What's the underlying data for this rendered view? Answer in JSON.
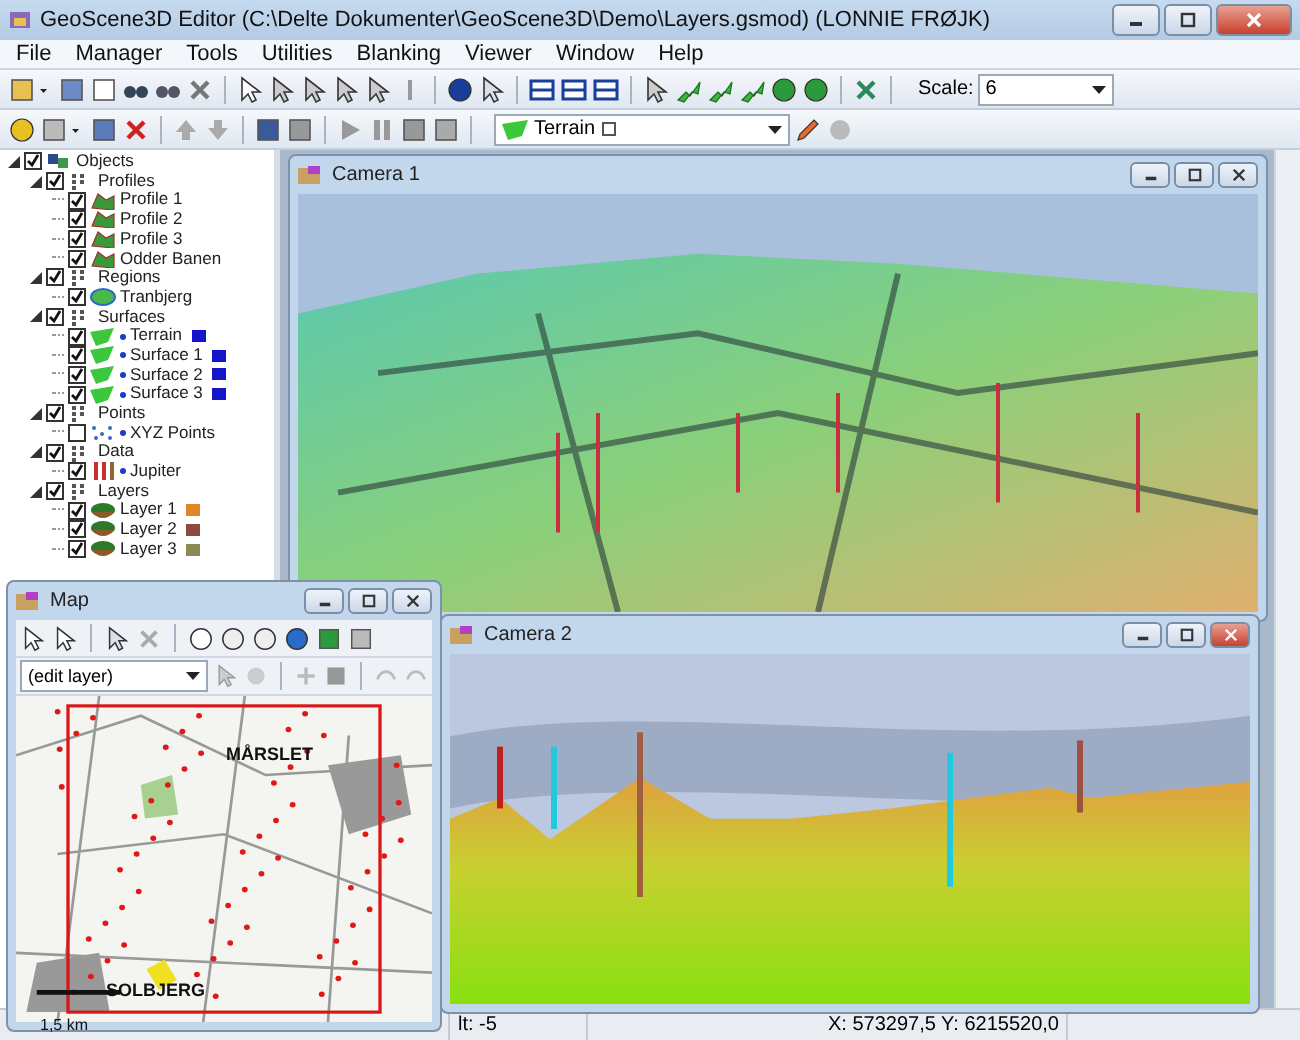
{
  "window": {
    "title": "GeoScene3D Editor (C:\\Delte Dokumenter\\GeoScene3D\\Demo\\Layers.gsmod) (LONNIE FRØJK)"
  },
  "menu": [
    "File",
    "Manager",
    "Tools",
    "Utilities",
    "Blanking",
    "Viewer",
    "Window",
    "Help"
  ],
  "toolbar": {
    "scale_label": "Scale:",
    "scale_value": "6",
    "layer_dropdown": "Terrain"
  },
  "tree": [
    {
      "label": "Objects",
      "kind": "objects",
      "checked": true,
      "expanded": true,
      "children": [
        {
          "label": "Profiles",
          "kind": "group",
          "checked": true,
          "expanded": true,
          "children": [
            {
              "label": "Profile 1",
              "kind": "profile",
              "checked": true
            },
            {
              "label": "Profile 2",
              "kind": "profile",
              "checked": true
            },
            {
              "label": "Profile 3",
              "kind": "profile",
              "checked": true
            },
            {
              "label": "Odder Banen",
              "kind": "profile",
              "checked": true
            }
          ]
        },
        {
          "label": "Regions",
          "kind": "group",
          "checked": true,
          "expanded": true,
          "children": [
            {
              "label": "Tranbjerg",
              "kind": "region",
              "checked": true
            }
          ]
        },
        {
          "label": "Surfaces",
          "kind": "group",
          "checked": true,
          "expanded": true,
          "children": [
            {
              "label": "Terrain",
              "kind": "surface",
              "checked": true,
              "color": "#1414c8"
            },
            {
              "label": "Surface 1",
              "kind": "surface",
              "checked": true,
              "color": "#1414c8"
            },
            {
              "label": "Surface 2",
              "kind": "surface",
              "checked": true,
              "color": "#1414c8"
            },
            {
              "label": "Surface 3",
              "kind": "surface",
              "checked": true,
              "color": "#1414c8"
            }
          ]
        },
        {
          "label": "Points",
          "kind": "group",
          "checked": true,
          "expanded": true,
          "children": [
            {
              "label": "XYZ Points",
              "kind": "points",
              "checked": false
            }
          ]
        },
        {
          "label": "Data",
          "kind": "group",
          "checked": true,
          "expanded": true,
          "children": [
            {
              "label": "Jupiter",
              "kind": "data",
              "checked": true
            }
          ]
        },
        {
          "label": "Layers",
          "kind": "group",
          "checked": true,
          "expanded": true,
          "children": [
            {
              "label": "Layer 1",
              "kind": "layer",
              "checked": true,
              "color": "#e0862a"
            },
            {
              "label": "Layer 2",
              "kind": "layer",
              "checked": true,
              "color": "#8c4a40"
            },
            {
              "label": "Layer 3",
              "kind": "layer",
              "checked": true,
              "color": "#8a8a52"
            }
          ]
        }
      ]
    }
  ],
  "camera_windows": [
    {
      "title": "Camera 1"
    },
    {
      "title": "Camera 2"
    }
  ],
  "map_window": {
    "title": "Map",
    "edit_dropdown": "(edit layer)",
    "place_labels": [
      "MÅRSLET",
      "SOLBJERG"
    ],
    "scale_label": "1,5 km"
  },
  "status_bar": [
    "lt: -5",
    "X: 573297,5  Y: 6215520,0"
  ]
}
